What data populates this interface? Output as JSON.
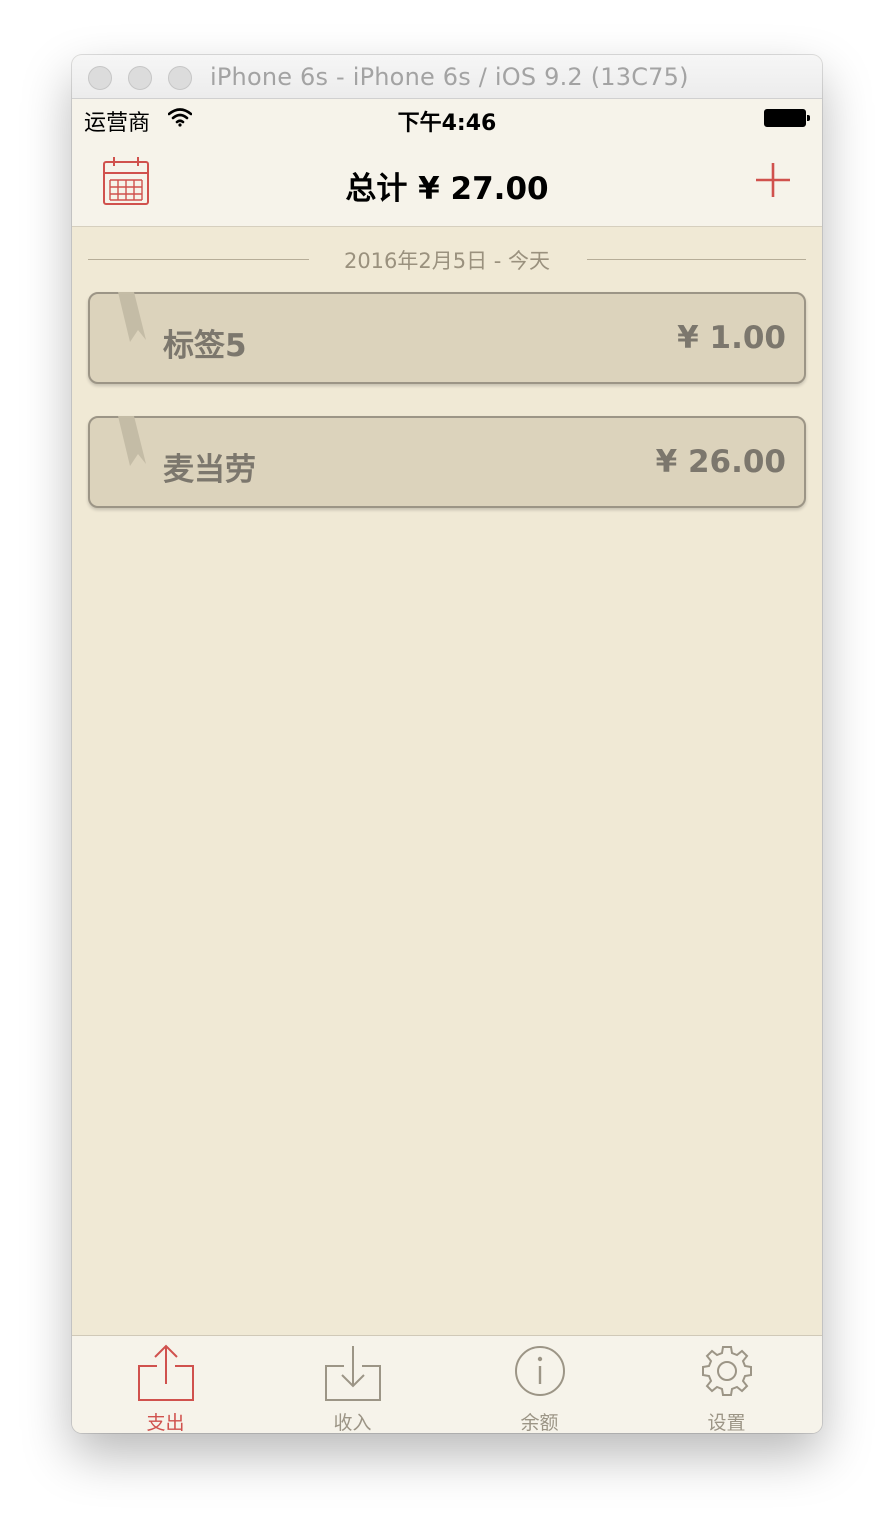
{
  "window": {
    "title": "iPhone 6s - iPhone 6s / iOS 9.2 (13C75)"
  },
  "status_bar": {
    "carrier": "运营商",
    "time": "下午4:46"
  },
  "nav": {
    "title": "总计 ¥ 27.00",
    "left_icon": "calendar-icon",
    "right_icon": "plus-icon"
  },
  "date_header": "2016年2月5日 - 今天",
  "entries": [
    {
      "name": "标签5",
      "amount": "¥ 1.00"
    },
    {
      "name": "麦当劳",
      "amount": "¥ 26.00"
    }
  ],
  "tabs": [
    {
      "label": "支出",
      "icon": "export-icon",
      "active": true
    },
    {
      "label": "收入",
      "icon": "import-icon",
      "active": false
    },
    {
      "label": "余额",
      "icon": "info-icon",
      "active": false
    },
    {
      "label": "设置",
      "icon": "gear-icon",
      "active": false
    }
  ],
  "colors": {
    "accent": "#d0514d",
    "background": "#f0e9d5",
    "card": "#dcd3bc",
    "inactive": "#9c9586",
    "bar": "#f6f3ea"
  }
}
